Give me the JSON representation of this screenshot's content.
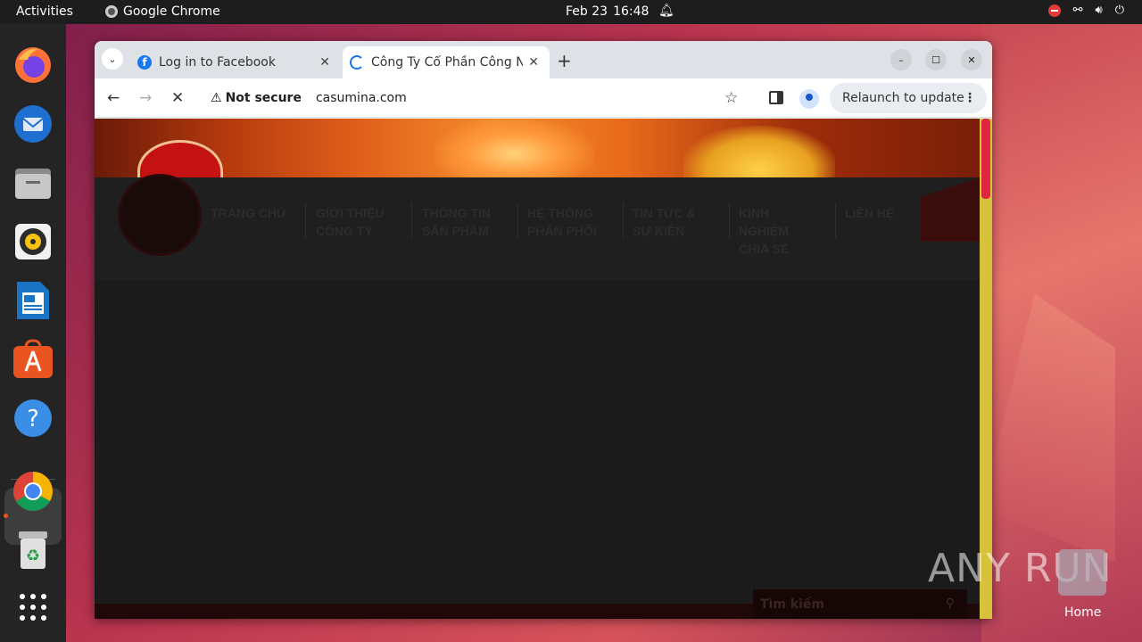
{
  "topbar": {
    "activities": "Activities",
    "app_name": "Google Chrome",
    "date": "Feb 23",
    "time": "16:48"
  },
  "dock": {
    "items": [
      "firefox-icon",
      "thunderbird-icon",
      "files-icon",
      "rhythmbox-icon",
      "writer-icon",
      "app-center-icon",
      "help-icon",
      "chrome-icon",
      "trash-icon",
      "apps-grid-icon"
    ]
  },
  "browser": {
    "tabs": [
      {
        "title": "Log in to Facebook"
      },
      {
        "title": "Công Ty Cổ Phần Công N"
      }
    ],
    "security_label": "Not secure",
    "url": "casumina.com",
    "relaunch_label": "Relaunch to update"
  },
  "site": {
    "nav": [
      {
        "line1": "TRANG CHỦ",
        "line2": "",
        "line3": ""
      },
      {
        "line1": "GIỚI THIỆU",
        "line2": "CÔNG TY",
        "line3": ""
      },
      {
        "line1": "THÔNG TIN",
        "line2": "SẢN PHẨM",
        "line3": ""
      },
      {
        "line1": "HỆ THỐNG",
        "line2": "PHÂN PHỐI",
        "line3": ""
      },
      {
        "line1": "TIN TỨC &",
        "line2": "SỰ KIỆN",
        "line3": ""
      },
      {
        "line1": "KINH",
        "line2": "NGHIỆM",
        "line3": "CHIA SẺ"
      },
      {
        "line1": "LIÊN HỆ",
        "line2": "",
        "line3": ""
      }
    ],
    "search_placeholder": "Tìm kiếm"
  },
  "desktop": {
    "home_label": "Home",
    "watermark": "ANY RUN"
  },
  "colors": {
    "scrollbar": "#d6c23b",
    "scroll_thumb": "#e0263e",
    "page_bg": "#1a1a1a"
  }
}
